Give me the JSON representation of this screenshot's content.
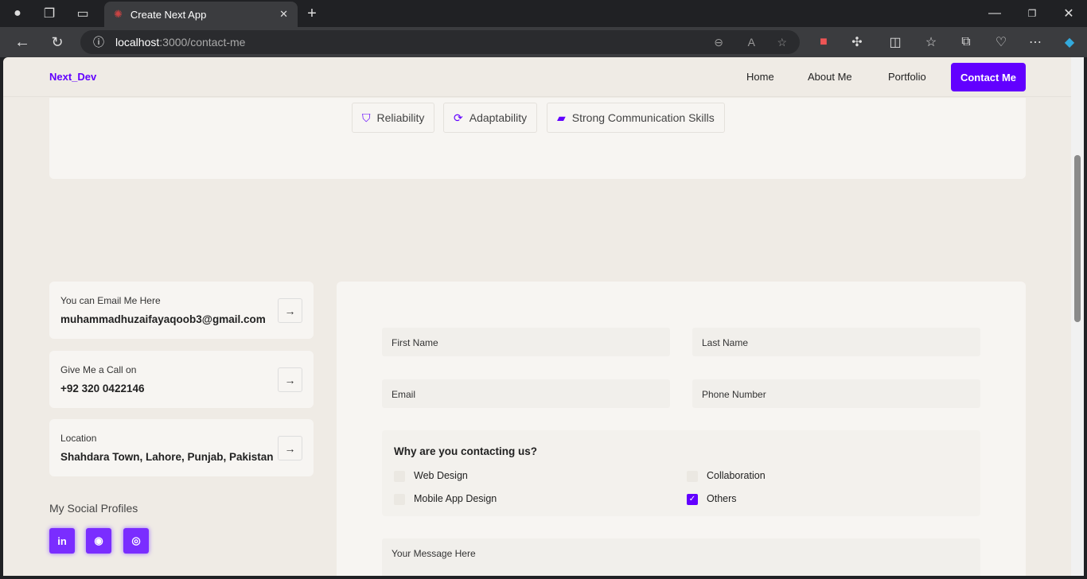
{
  "browser": {
    "tab_title": "Create Next App",
    "url_host": "localhost",
    "url_path": ":3000/contact-me"
  },
  "nav": {
    "logo": "Next_Dev",
    "links": [
      "Home",
      "About Me",
      "Portfolio"
    ],
    "cta": "Contact Me"
  },
  "skills": [
    {
      "label": "Reliability",
      "icon": "shield-icon"
    },
    {
      "label": "Adaptability",
      "icon": "refresh-check-icon"
    },
    {
      "label": "Strong Communication Skills",
      "icon": "chat-check-icon"
    }
  ],
  "contact": [
    {
      "label": "You can Email Me Here",
      "value": "muhammadhuzaifayaqoob3@gmail.com"
    },
    {
      "label": "Give Me a Call on",
      "value": "+92 320 0422146"
    },
    {
      "label": "Location",
      "value": "Shahdara Town, Lahore, Punjab, Pakistan"
    }
  ],
  "social": {
    "title": "My Social Profiles",
    "items": [
      "LinkedIn",
      "GitHub",
      "Instagram"
    ]
  },
  "form": {
    "first_name": "First Name",
    "last_name": "Last Name",
    "email": "Email",
    "phone": "Phone Number",
    "question": "Why are you contacting us?",
    "options": [
      {
        "label": "Web Design",
        "checked": false
      },
      {
        "label": "Collaboration",
        "checked": false
      },
      {
        "label": "Mobile App Design",
        "checked": false
      },
      {
        "label": "Others",
        "checked": true
      }
    ],
    "message": "Your Message Here"
  },
  "colors": {
    "accent": "#6200ff",
    "page_bg": "#efebe5",
    "card_bg": "#f7f5f2"
  }
}
